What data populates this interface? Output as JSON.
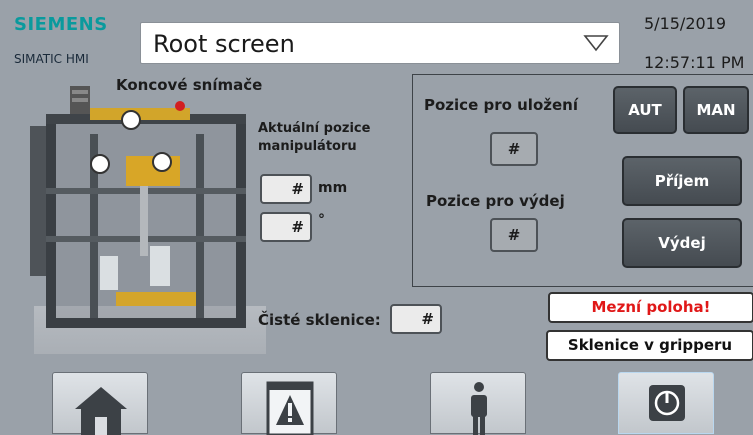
{
  "header": {
    "brand": "SIEMENS",
    "product": "SIMATIC HMI",
    "screen_name": "Root screen",
    "date": "5/15/2019",
    "time": "12:57:11 PM"
  },
  "machine": {
    "title": "Koncové snímače"
  },
  "current_position": {
    "label": "Aktuální pozice manipulátoru",
    "value_mm": "#",
    "unit_mm": "mm",
    "value_deg": "#",
    "unit_deg": "°"
  },
  "panel": {
    "store_label": "Pozice pro uložení",
    "store_value": "#",
    "issue_label": "Pozice pro výdej",
    "issue_value": "#",
    "aut_label": "AUT",
    "man_label": "MAN",
    "receive_label": "Příjem",
    "issue_button_label": "Výdej"
  },
  "clean_glasses": {
    "label": "Čisté sklenice:",
    "value": "#"
  },
  "status": {
    "limit_alarm": "Mezní poloha!",
    "gripper": "Sklenice v gripperu",
    "alarm_color": "#e01818"
  },
  "nav": {
    "icons": [
      "home-icon",
      "alarm-icon",
      "user-icon",
      "power-icon"
    ]
  },
  "colors": {
    "background": "#9aa1a9",
    "brand": "#0a9a9d"
  }
}
